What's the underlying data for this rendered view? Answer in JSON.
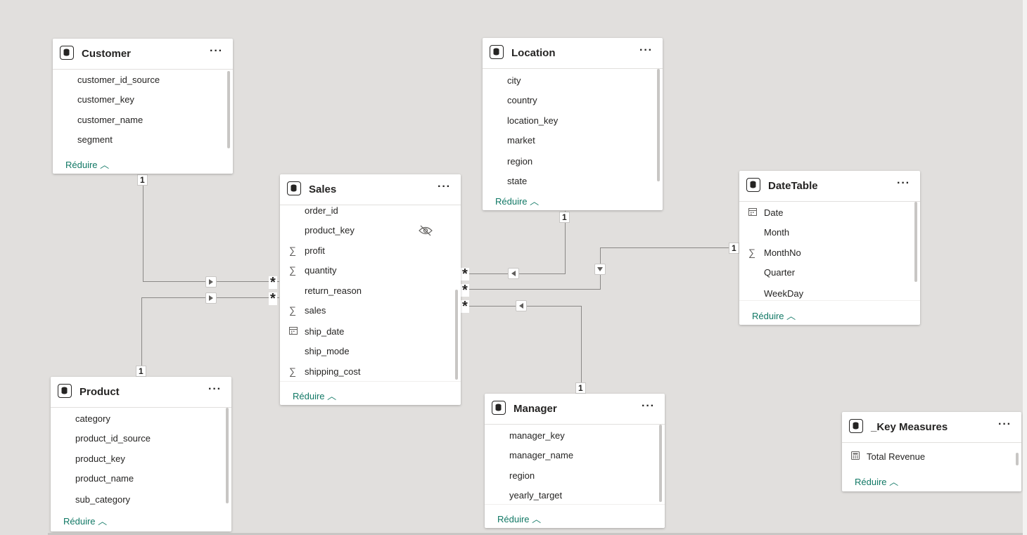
{
  "tables": {
    "customer": {
      "title": "Customer",
      "fields": [
        "customer_id_source",
        "customer_key",
        "customer_name",
        "segment"
      ],
      "collapse_label": "Réduire"
    },
    "location": {
      "title": "Location",
      "fields": [
        "city",
        "country",
        "location_key",
        "market",
        "region",
        "state"
      ],
      "collapse_label": "Réduire"
    },
    "sales": {
      "title": "Sales",
      "fields": [
        {
          "name": "order_id",
          "icon": ""
        },
        {
          "name": "product_key",
          "icon": "",
          "hidden": true
        },
        {
          "name": "profit",
          "icon": "sigma"
        },
        {
          "name": "quantity",
          "icon": "sigma"
        },
        {
          "name": "return_reason",
          "icon": ""
        },
        {
          "name": "sales",
          "icon": "sigma"
        },
        {
          "name": "ship_date",
          "icon": "calendar"
        },
        {
          "name": "ship_mode",
          "icon": ""
        },
        {
          "name": "shipping_cost",
          "icon": "sigma"
        }
      ],
      "collapse_label": "Réduire"
    },
    "datetable": {
      "title": "DateTable",
      "fields": [
        {
          "name": "Date",
          "icon": "calendar"
        },
        {
          "name": "Month",
          "icon": ""
        },
        {
          "name": "MonthNo",
          "icon": "sigma"
        },
        {
          "name": "Quarter",
          "icon": ""
        },
        {
          "name": "WeekDay",
          "icon": ""
        }
      ],
      "collapse_label": "Réduire"
    },
    "product": {
      "title": "Product",
      "fields": [
        "category",
        "product_id_source",
        "product_key",
        "product_name",
        "sub_category"
      ],
      "collapse_label": "Réduire"
    },
    "manager": {
      "title": "Manager",
      "fields": [
        "manager_key",
        "manager_name",
        "region",
        "yearly_target"
      ],
      "collapse_label": "Réduire"
    },
    "key_measures": {
      "title": "_Key Measures",
      "fields": [
        {
          "name": "Total Revenue",
          "icon": "calculator"
        }
      ],
      "collapse_label": "Réduire"
    }
  },
  "relationships": {
    "one_label": "1",
    "many_label": "*"
  },
  "icons": {
    "table": "database-icon",
    "more": "more-options-icon",
    "sigma": "sum-icon",
    "calendar": "calendar-icon",
    "calculator": "calculator-icon",
    "hidden": "eye-hidden-icon",
    "collapse": "chevron-up-icon",
    "filter_direction": "filter-direction-icon"
  },
  "colors": {
    "canvas": "#e1dfdd",
    "accent": "#117865",
    "line": "#8a8886"
  }
}
